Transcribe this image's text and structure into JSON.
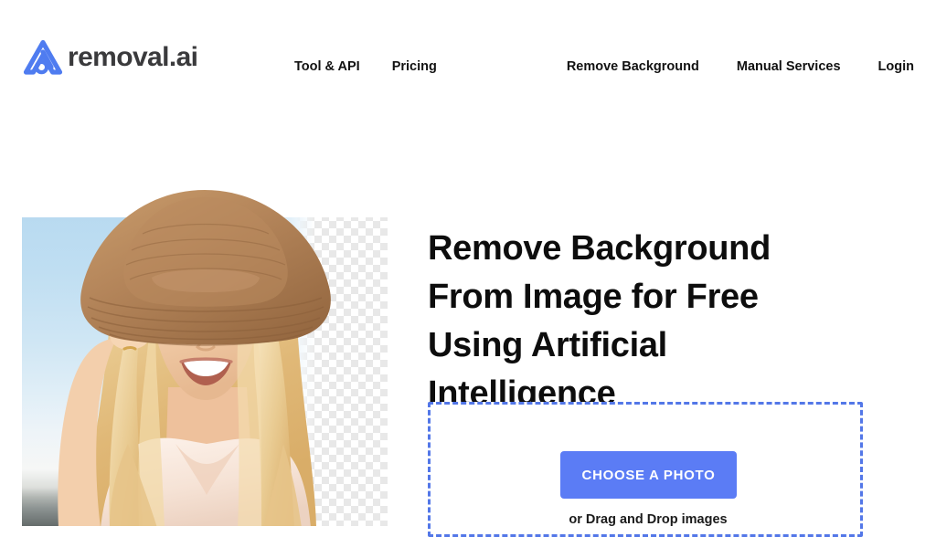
{
  "brand": {
    "logo_icon": "removal-ai-logo-icon",
    "wordmark": "removal.ai",
    "accent_color": "#5b7cf5",
    "wordmark_color": "#3a3a3c"
  },
  "nav": {
    "left_items": [
      {
        "label": "Tool & API"
      },
      {
        "label": "Pricing"
      }
    ],
    "right_items": [
      {
        "label": "Remove Background"
      },
      {
        "label": "Manual Services"
      },
      {
        "label": "Login"
      }
    ]
  },
  "hero": {
    "image_alt": "Smiling blonde woman wearing a straw hat, half original sky background and half transparent checkerboard",
    "checker_color": "#d6d6d6",
    "sky_color": "#b3d7ef"
  },
  "main": {
    "headline": "Remove Background From Image for Free Using Artificial Intelligence",
    "headline_lines": [
      "Remove Background From",
      "Image for Free Using",
      "Artificial Intelligence"
    ],
    "dropzone": {
      "button_label": "CHOOSE A PHOTO",
      "drag_text": "or Drag and Drop images",
      "border_color": "#5377e8",
      "button_color": "#5b7cf5"
    }
  }
}
